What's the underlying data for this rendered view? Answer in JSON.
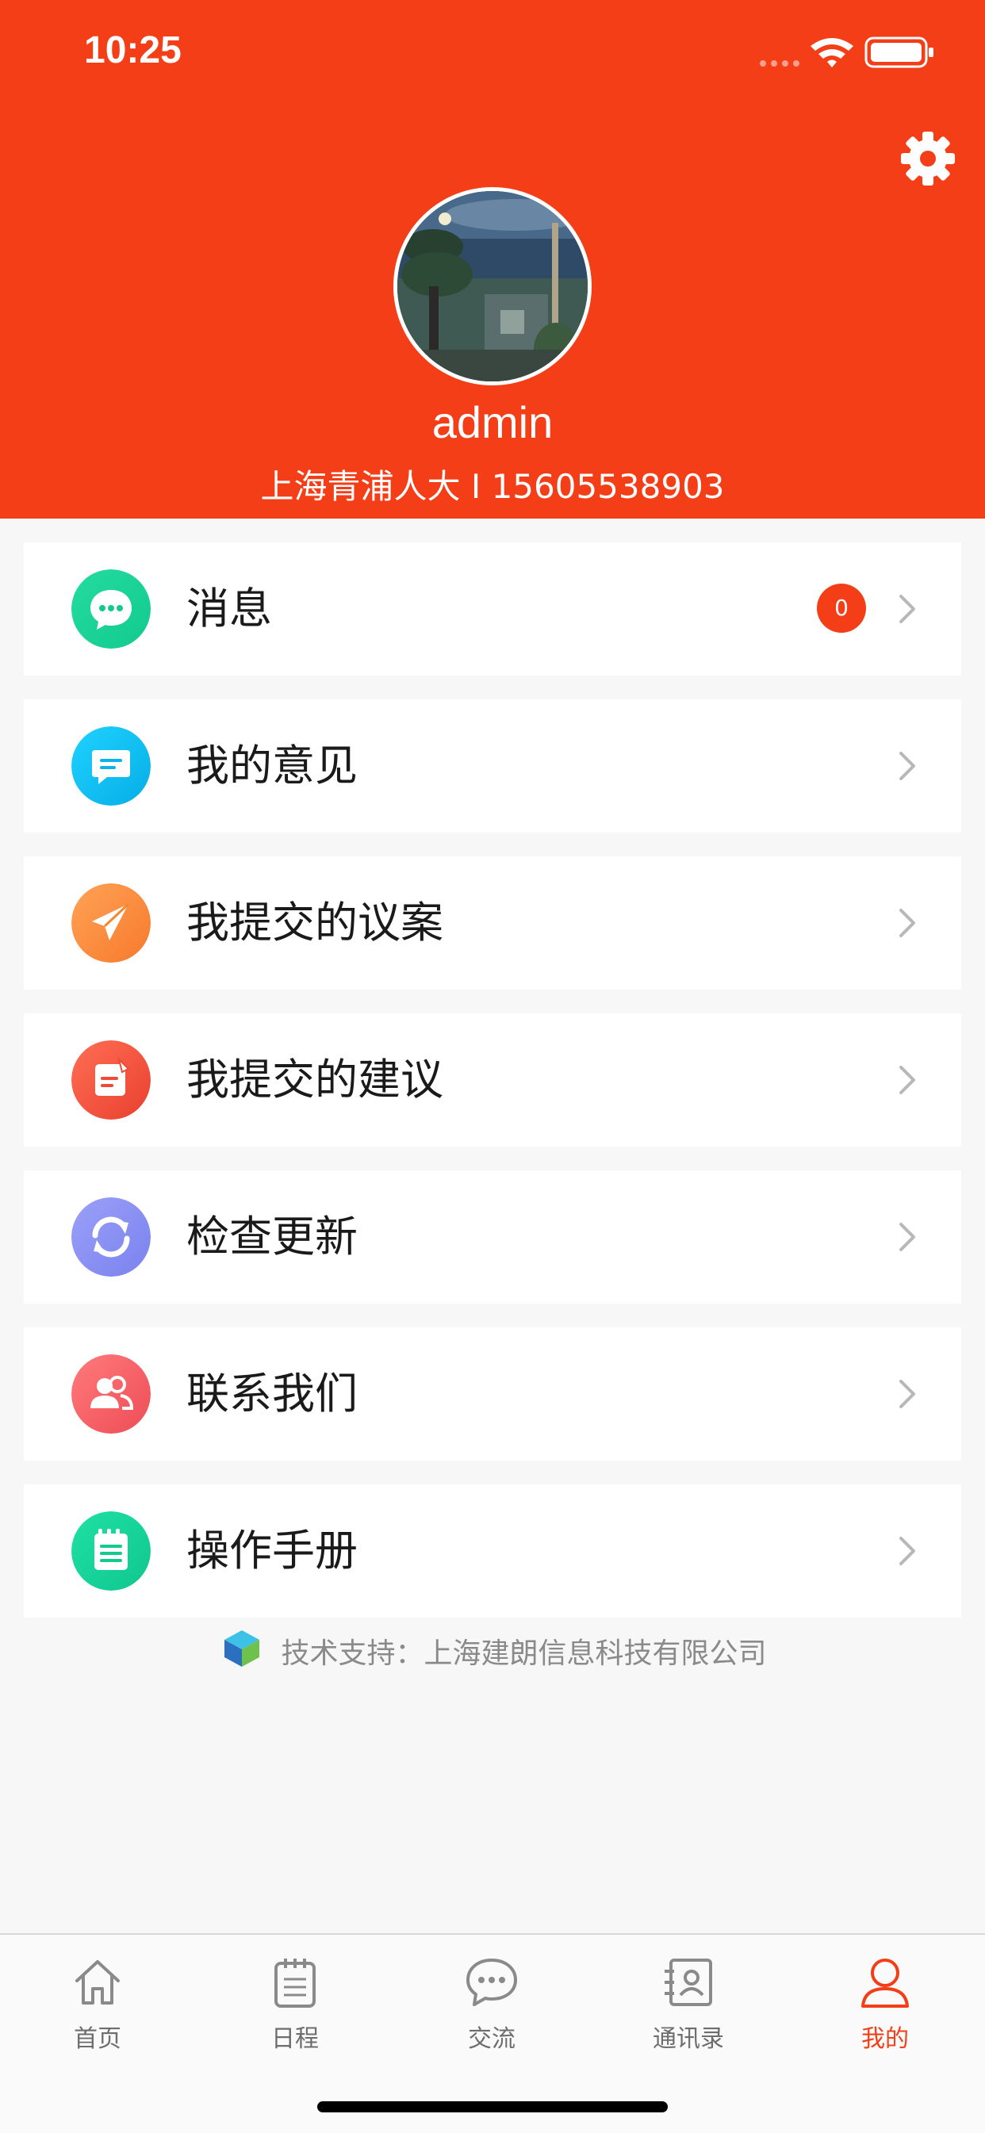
{
  "status_bar": {
    "time": "10:25"
  },
  "profile": {
    "name": "admin",
    "info": "上海青浦人大 I 15605538903"
  },
  "menu": [
    {
      "label": "消息",
      "icon": "message-icon",
      "color": "#1ed49a",
      "badge": "0"
    },
    {
      "label": "我的意见",
      "icon": "comment-icon",
      "color": "#10c4f2"
    },
    {
      "label": "我提交的议案",
      "icon": "paper-plane-icon",
      "color": "#fb8d40"
    },
    {
      "label": "我提交的建议",
      "icon": "edit-note-icon",
      "color": "#f2533e"
    },
    {
      "label": "检查更新",
      "icon": "refresh-icon",
      "color": "#8b8ff2"
    },
    {
      "label": "联系我们",
      "icon": "contacts-icon",
      "color": "#f35c63"
    },
    {
      "label": "操作手册",
      "icon": "manual-icon",
      "color": "#13d39b"
    }
  ],
  "footer": {
    "support_text": "技术支持：上海建朗信息科技有限公司"
  },
  "tabs": [
    {
      "label": "首页",
      "icon": "home-icon"
    },
    {
      "label": "日程",
      "icon": "calendar-icon"
    },
    {
      "label": "交流",
      "icon": "chat-icon"
    },
    {
      "label": "通讯录",
      "icon": "address-book-icon"
    },
    {
      "label": "我的",
      "icon": "user-icon",
      "active": true
    }
  ],
  "colors": {
    "accent": "#f33e18",
    "background": "#f7f7f7"
  }
}
